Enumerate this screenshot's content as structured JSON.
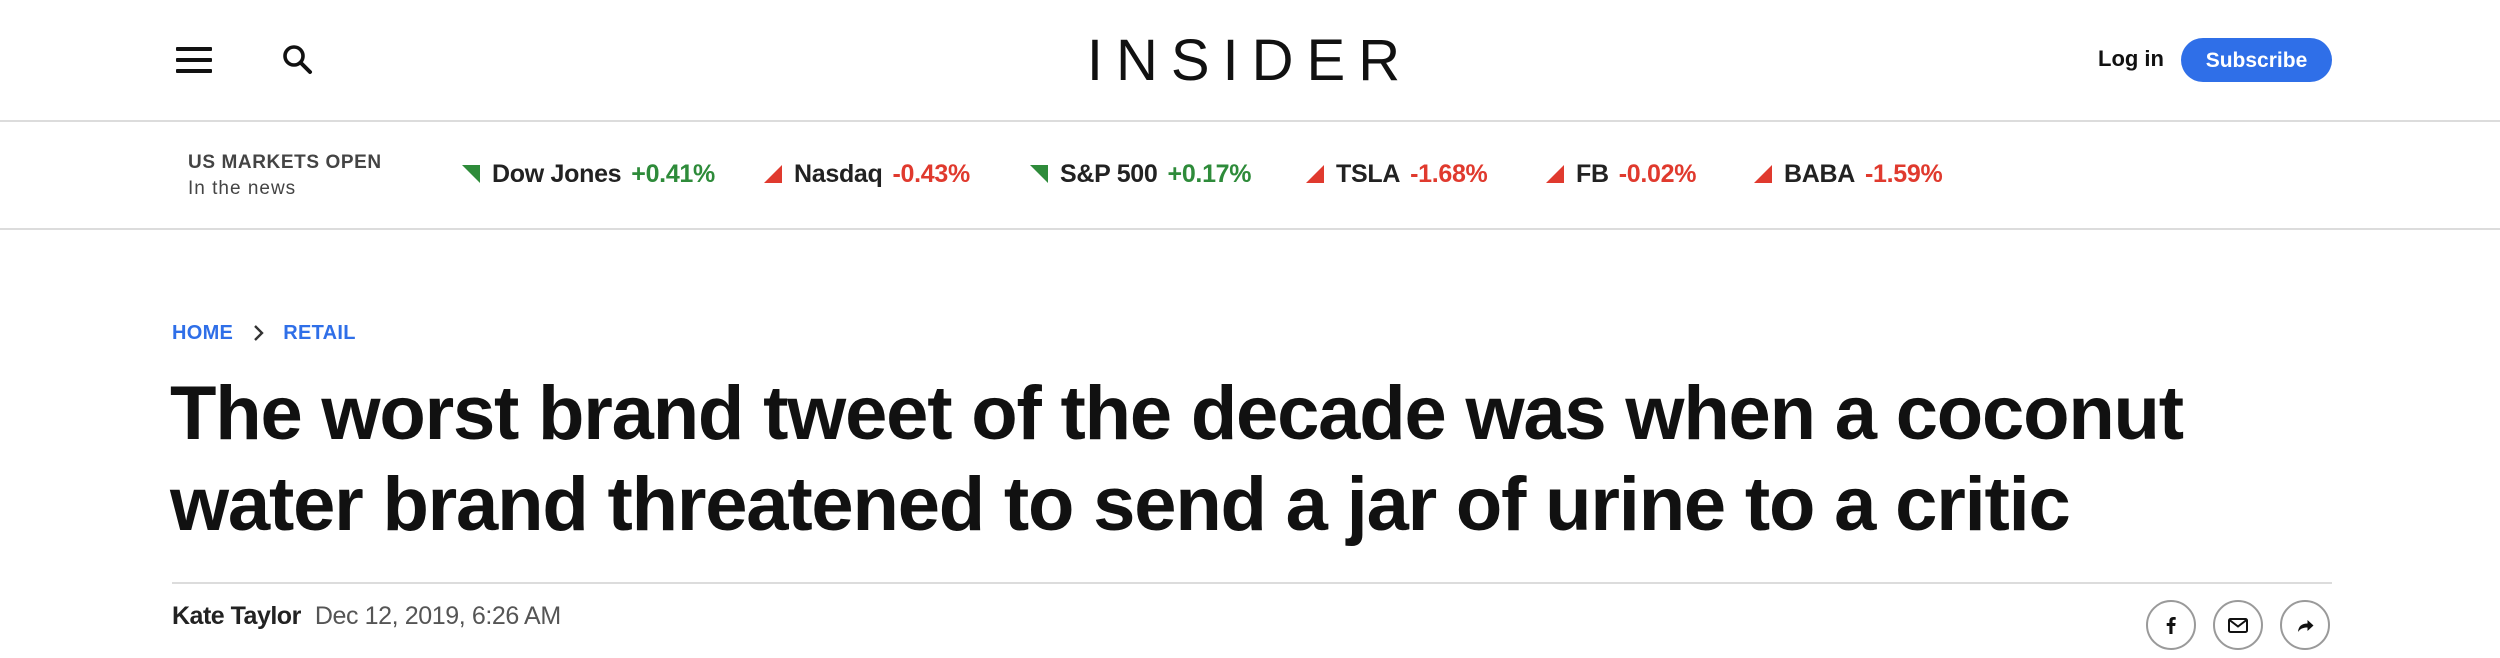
{
  "header": {
    "menu_icon": "hamburger-menu-icon",
    "search_icon": "search-icon",
    "logo": "INSIDER",
    "login_label": "Log in",
    "subscribe_label": "Subscribe",
    "accent_color": "#2f6fe8"
  },
  "markets": {
    "title": "US MARKETS OPEN",
    "subtitle": "In the news",
    "tickers": [
      {
        "name": "Dow Jones",
        "change": "+0.41%",
        "direction": "up",
        "color": "#2e8b3a"
      },
      {
        "name": "Nasdaq",
        "change": "-0.43%",
        "direction": "down",
        "color": "#e03a2e"
      },
      {
        "name": "S&P 500",
        "change": "+0.17%",
        "direction": "up",
        "color": "#2e8b3a"
      },
      {
        "name": "TSLA",
        "change": "-1.68%",
        "direction": "down",
        "color": "#e03a2e"
      },
      {
        "name": "FB",
        "change": "-0.02%",
        "direction": "down",
        "color": "#e03a2e"
      },
      {
        "name": "BABA",
        "change": "-1.59%",
        "direction": "down",
        "color": "#e03a2e"
      }
    ]
  },
  "breadcrumb": {
    "items": [
      "HOME",
      "RETAIL"
    ],
    "separator_icon": "chevron-right-icon"
  },
  "article": {
    "headline": "The worst brand tweet of the decade was when a coconut water brand threatened to send a jar of urine to a critic",
    "author": "Kate Taylor",
    "date": "Dec 12, 2019, 6:26 AM"
  },
  "share": {
    "icons": [
      "facebook-icon",
      "email-icon",
      "share-arrow-icon"
    ]
  }
}
